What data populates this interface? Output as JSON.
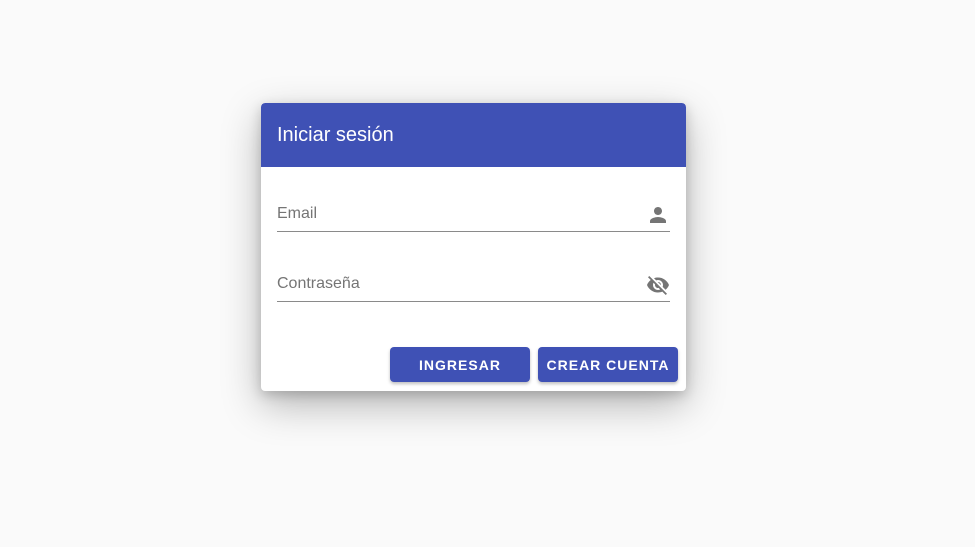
{
  "login": {
    "title": "Iniciar sesión",
    "email_placeholder": "Email",
    "password_placeholder": "Contraseña",
    "email_icon": "person-icon",
    "password_icon": "visibility-off-icon",
    "login_button": "INGRESAR",
    "create_account_button": "CREAR CUENTA"
  },
  "colors": {
    "accent": "#3f51b5",
    "background": "#fafafa",
    "card": "#ffffff",
    "icon": "#757575"
  }
}
